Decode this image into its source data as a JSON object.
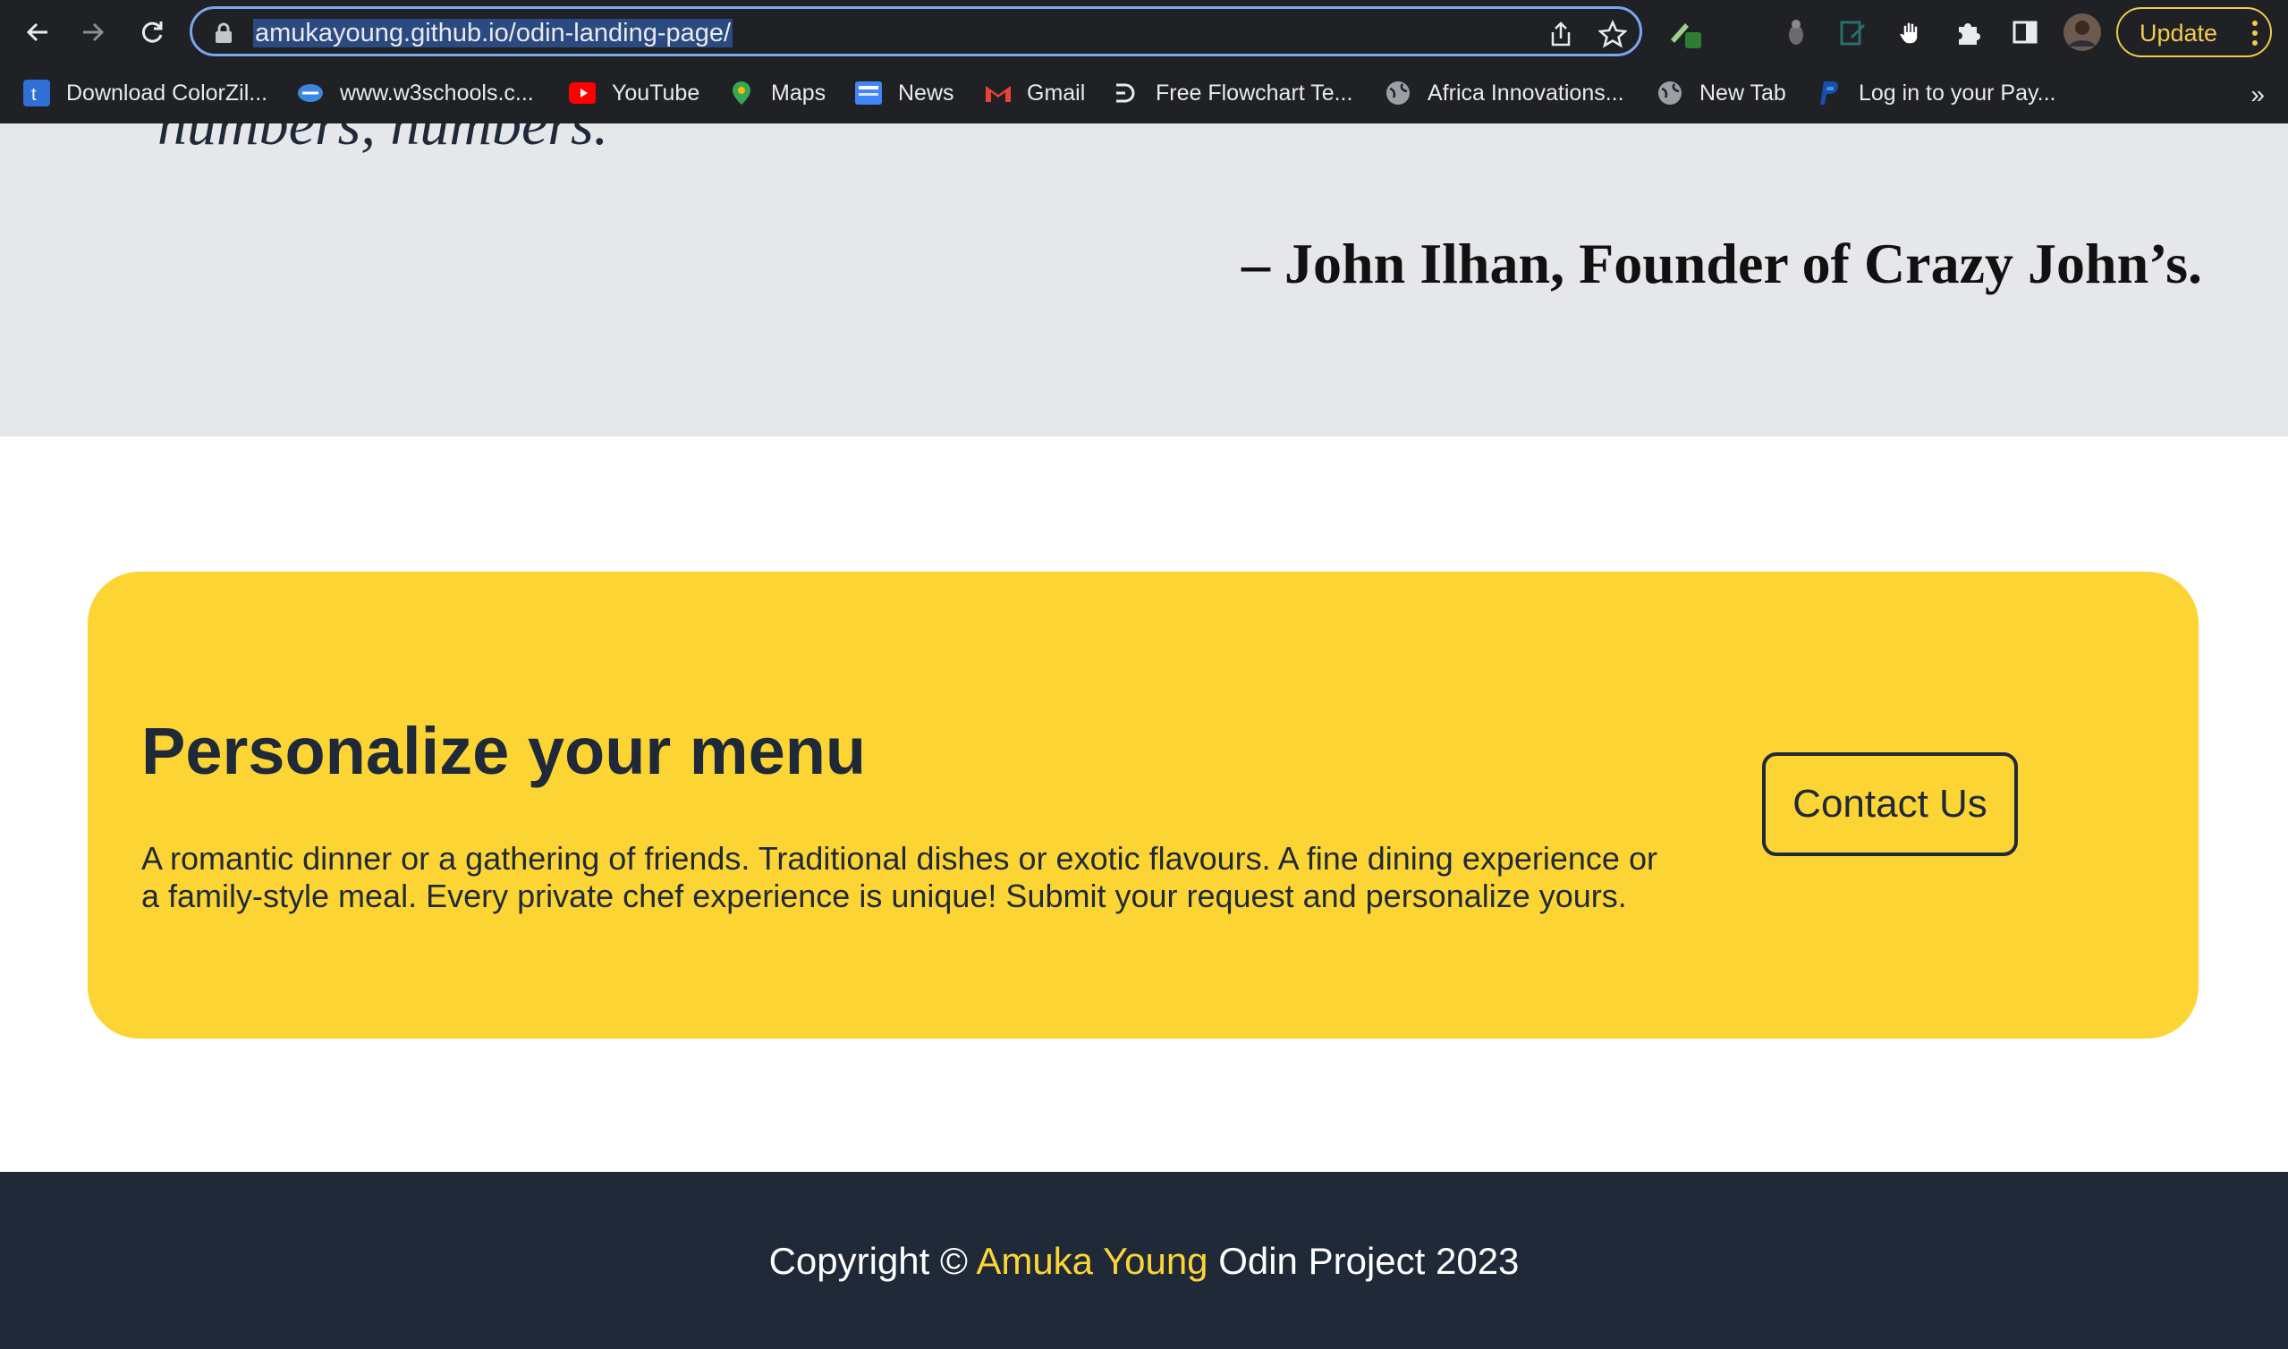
{
  "browser": {
    "url": "amukayoung.github.io/odin-landing-page/",
    "update_label": "Update",
    "bookmarks": [
      {
        "label": "Download ColorZil...",
        "icon": "colorzilla-icon"
      },
      {
        "label": "www.w3schools.c...",
        "icon": "w3schools-icon"
      },
      {
        "label": "YouTube",
        "icon": "youtube-icon"
      },
      {
        "label": "Maps",
        "icon": "maps-icon"
      },
      {
        "label": "News",
        "icon": "news-icon"
      },
      {
        "label": "Gmail",
        "icon": "gmail-icon"
      },
      {
        "label": "Free Flowchart Te...",
        "icon": "flowchart-icon"
      },
      {
        "label": "Africa Innovations...",
        "icon": "globe-icon"
      },
      {
        "label": "New Tab",
        "icon": "globe-icon"
      },
      {
        "label": "Log in to your Pay...",
        "icon": "paypal-icon"
      }
    ],
    "more_bookmarks": "»"
  },
  "quote": {
    "text": "numbers, numbers.",
    "author": "– John Ilhan, Founder of Crazy John’s."
  },
  "cta": {
    "title": "Personalize your menu",
    "body": "A romantic dinner or a gathering of friends. Traditional dishes or exotic flavours. A fine dining experience or a family-style meal. Every private chef experience is unique! Submit your request and personalize yours.",
    "button_label": "Contact Us"
  },
  "footer": {
    "prefix": "Copyright ©",
    "name": "Amuka Young",
    "suffix": "Odin Project 2023"
  },
  "colors": {
    "accent_yellow": "#fcd535",
    "footer_bg": "#1f2937",
    "quote_bg": "#e5e7eb"
  }
}
